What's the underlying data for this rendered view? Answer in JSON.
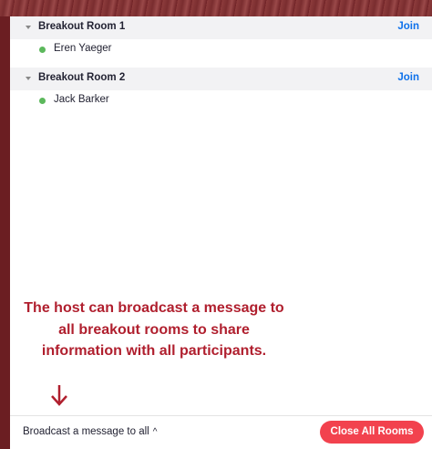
{
  "rooms": [
    {
      "title": "Breakout Room 1",
      "join_label": "Join",
      "participants": [
        {
          "name": "Eren Yaeger",
          "status_color": "#5cb85c"
        }
      ]
    },
    {
      "title": "Breakout Room 2",
      "join_label": "Join",
      "participants": [
        {
          "name": "Jack Barker",
          "status_color": "#5cb85c"
        }
      ]
    }
  ],
  "annotation": {
    "lines": [
      "The host can broadcast a message to",
      "all breakout rooms to share",
      "information with all participants."
    ],
    "color": "#b01f2e",
    "arrow_icon": "down-arrow-icon"
  },
  "footer": {
    "broadcast_label": "Broadcast a message to all",
    "broadcast_chevron": "^",
    "close_all_label": "Close All Rooms",
    "close_all_color": "#f2424e"
  },
  "colors": {
    "join": "#0e71eb",
    "frame": "#6b1e22"
  }
}
